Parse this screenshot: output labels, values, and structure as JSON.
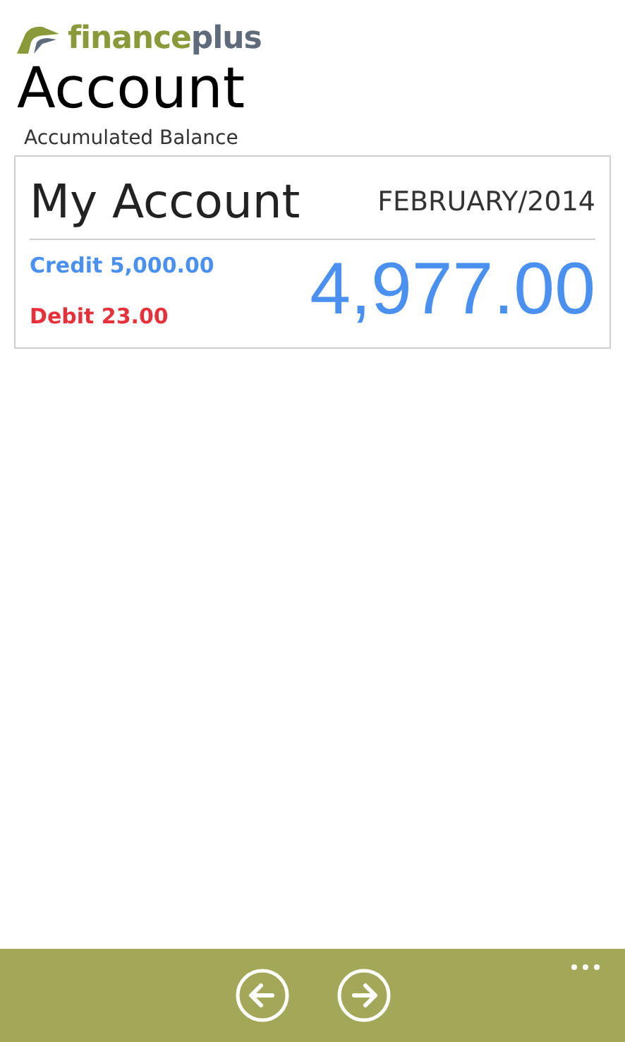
{
  "logo": {
    "first": "finance",
    "second": "plus"
  },
  "page_title": "Account",
  "subtitle": "Accumulated Balance",
  "card": {
    "title": "My Account",
    "period": "FEBRUARY/2014",
    "credit": "Credit 5,000.00",
    "debit": "Debit 23.00",
    "balance": "4,977.00"
  },
  "app_bar": {
    "buttons": [
      {
        "kind": "back"
      },
      {
        "kind": "forward"
      }
    ],
    "more": true
  }
}
